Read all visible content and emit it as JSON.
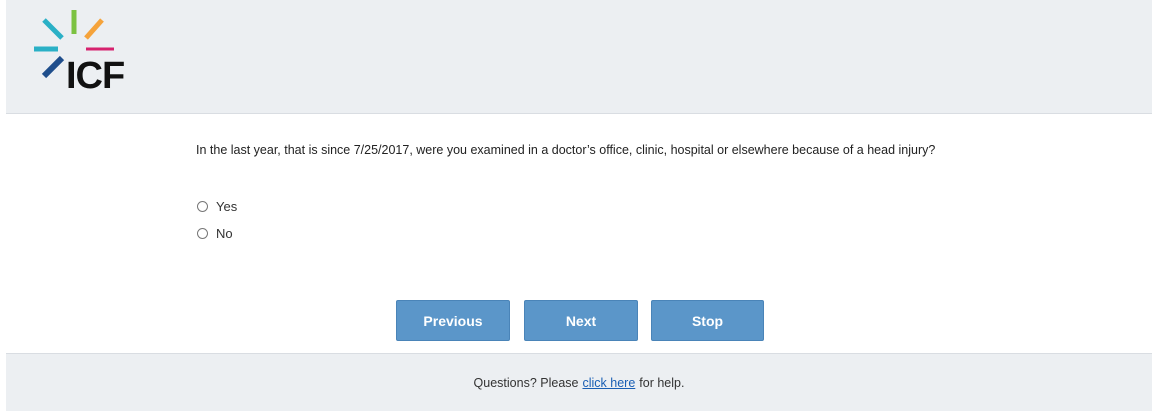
{
  "brand": {
    "logo_text": "ICF",
    "logo_icon": "icf-starburst-logo"
  },
  "question": {
    "text": "In the last year, that is since 7/25/2017, were you examined in a doctor’s office, clinic, hospital or elsewhere because of a head injury?"
  },
  "options": [
    {
      "label": "Yes",
      "selected": false
    },
    {
      "label": "No",
      "selected": false
    }
  ],
  "buttons": {
    "previous": "Previous",
    "next": "Next",
    "stop": "Stop"
  },
  "footer": {
    "prefix": "Questions? Please",
    "link": "click here",
    "suffix": "for help."
  },
  "colors": {
    "button_bg": "#5b96c9",
    "panel_bg": "#eceff2",
    "link": "#1a5fb4"
  }
}
